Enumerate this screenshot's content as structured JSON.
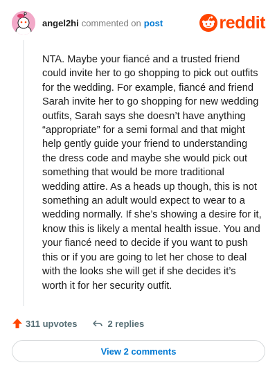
{
  "header": {
    "username": "angel2hi",
    "commented_text": "commented on",
    "post_link": "post",
    "brand": "reddit"
  },
  "comment": {
    "lines": [
      "NTA. Maybe your fiancé and a trusted friend",
      "could invite her to go shopping to pick out outfits",
      "for the wedding. For example, fiancé and friend",
      "Sarah invite her to go shopping for new wedding",
      "outfits, Sarah says she doesn’t have anything",
      "“appropriate” for a semi formal and that might",
      "help gently guide your friend to understanding",
      "the dress code and maybe she would pick out",
      "something that would be more traditional",
      "wedding attire. As a heads up though, this is not",
      "something an adult would expect to wear to a",
      "wedding normally. If she’s showing a desire for it,",
      "know this is likely a mental health issue. You and",
      "your fiancé need to decide if you want to push",
      "this or if you are going to let her chose to deal",
      "with the looks she will get if she decides it’s",
      "worth it for her security outfit."
    ]
  },
  "actions": {
    "upvotes": "311 upvotes",
    "replies": "2 replies"
  },
  "view_comments_label": "View 2 comments",
  "colors": {
    "brand": "#ff4500",
    "link": "#0079d3",
    "muted": "#7c7c7c",
    "avatar_bg": "#f2a9c8"
  },
  "icons": {
    "avatar": "snoo-avatar-icon",
    "logo": "reddit-snoo-icon",
    "upvote": "upvote-arrow-icon",
    "reply": "reply-arrow-icon"
  }
}
